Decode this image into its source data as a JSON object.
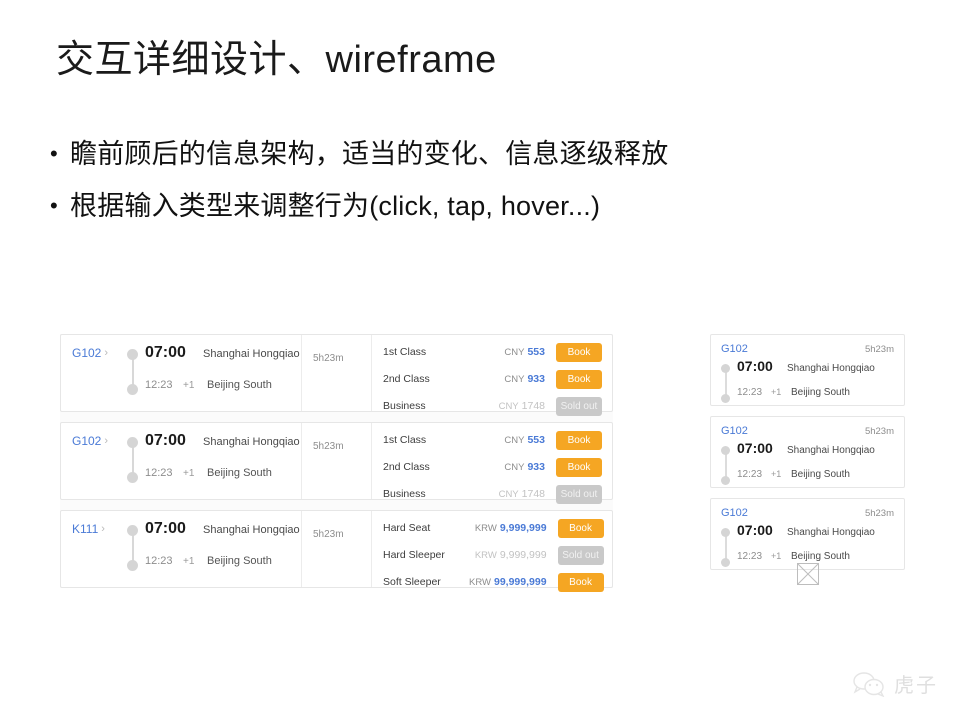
{
  "slide": {
    "title": "交互详细设计、wireframe",
    "bullet_marker": "•",
    "bullets": [
      "瞻前顾后的信息架构，适当的变化、信息逐级释放",
      "根据输入类型来调整行为(click, tap, hover...)"
    ]
  },
  "colors": {
    "accent_blue": "#4a7ad6",
    "book_orange": "#f5a623",
    "soldout_gray": "#c9c9c9",
    "card_border": "#e6e6e6"
  },
  "desktop_list": {
    "chevron": "›",
    "rows": [
      {
        "train_no": "G102",
        "depart_time": "07:00",
        "arrive_time": "12:23",
        "day_offset": "+1",
        "from_station": "Shanghai Hongqiao",
        "to_station": "Beijing South",
        "duration": "5h23m",
        "classes": [
          {
            "name": "1st Class",
            "currency": "CNY",
            "amount": "553",
            "action": "Book",
            "sold_out": false
          },
          {
            "name": "2nd Class",
            "currency": "CNY",
            "amount": "933",
            "action": "Book",
            "sold_out": false
          },
          {
            "name": "Business",
            "currency": "CNY",
            "amount": "1748",
            "action": "Sold out",
            "sold_out": true
          }
        ]
      },
      {
        "train_no": "G102",
        "depart_time": "07:00",
        "arrive_time": "12:23",
        "day_offset": "+1",
        "from_station": "Shanghai Hongqiao",
        "to_station": "Beijing South",
        "duration": "5h23m",
        "classes": [
          {
            "name": "1st Class",
            "currency": "CNY",
            "amount": "553",
            "action": "Book",
            "sold_out": false
          },
          {
            "name": "2nd Class",
            "currency": "CNY",
            "amount": "933",
            "action": "Book",
            "sold_out": false
          },
          {
            "name": "Business",
            "currency": "CNY",
            "amount": "1748",
            "action": "Sold out",
            "sold_out": true
          }
        ]
      },
      {
        "train_no": "K111",
        "depart_time": "07:00",
        "arrive_time": "12:23",
        "day_offset": "+1",
        "from_station": "Shanghai Hongqiao",
        "to_station": "Beijing South",
        "duration": "5h23m",
        "classes": [
          {
            "name": "Hard Seat",
            "currency": "KRW",
            "amount": "9,999,999",
            "action": "Book",
            "sold_out": false
          },
          {
            "name": "Hard Sleeper",
            "currency": "KRW",
            "amount": "9,999,999",
            "action": "Sold out",
            "sold_out": true
          },
          {
            "name": "Soft Sleeper",
            "currency": "KRW",
            "amount": "99,999,999",
            "action": "Book",
            "sold_out": false
          }
        ]
      }
    ]
  },
  "mobile_list": {
    "cards": [
      {
        "train_no": "G102",
        "duration": "5h23m",
        "depart_time": "07:00",
        "arrive_time": "12:23",
        "day_offset": "+1",
        "from_station": "Shanghai Hongqiao",
        "to_station": "Beijing South"
      },
      {
        "train_no": "G102",
        "duration": "5h23m",
        "depart_time": "07:00",
        "arrive_time": "12:23",
        "day_offset": "+1",
        "from_station": "Shanghai Hongqiao",
        "to_station": "Beijing South"
      },
      {
        "train_no": "G102",
        "duration": "5h23m",
        "depart_time": "07:00",
        "arrive_time": "12:23",
        "day_offset": "+1",
        "from_station": "Shanghai Hongqiao",
        "to_station": "Beijing South"
      }
    ]
  },
  "watermark": {
    "text": "虎子",
    "icon": "wechat-icon"
  }
}
